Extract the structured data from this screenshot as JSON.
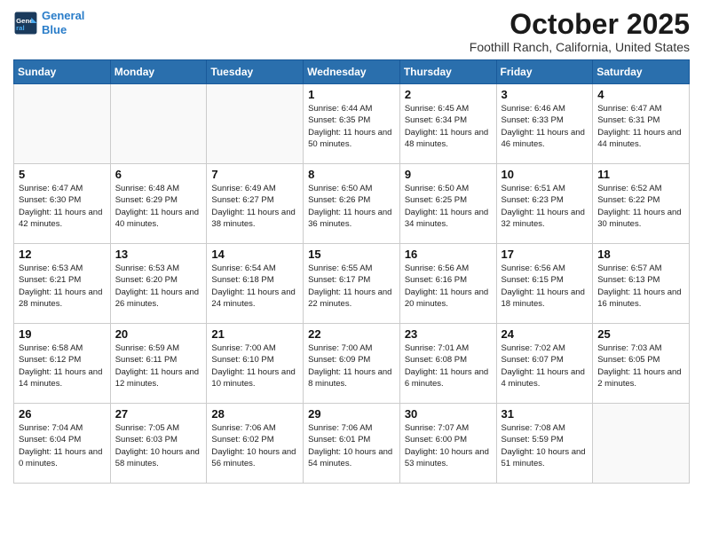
{
  "header": {
    "logo_line1": "General",
    "logo_line2": "Blue",
    "month": "October 2025",
    "location": "Foothill Ranch, California, United States"
  },
  "weekdays": [
    "Sunday",
    "Monday",
    "Tuesday",
    "Wednesday",
    "Thursday",
    "Friday",
    "Saturday"
  ],
  "weeks": [
    [
      {
        "day": "",
        "sunrise": "",
        "sunset": "",
        "daylight": ""
      },
      {
        "day": "",
        "sunrise": "",
        "sunset": "",
        "daylight": ""
      },
      {
        "day": "",
        "sunrise": "",
        "sunset": "",
        "daylight": ""
      },
      {
        "day": "1",
        "sunrise": "Sunrise: 6:44 AM",
        "sunset": "Sunset: 6:35 PM",
        "daylight": "Daylight: 11 hours and 50 minutes."
      },
      {
        "day": "2",
        "sunrise": "Sunrise: 6:45 AM",
        "sunset": "Sunset: 6:34 PM",
        "daylight": "Daylight: 11 hours and 48 minutes."
      },
      {
        "day": "3",
        "sunrise": "Sunrise: 6:46 AM",
        "sunset": "Sunset: 6:33 PM",
        "daylight": "Daylight: 11 hours and 46 minutes."
      },
      {
        "day": "4",
        "sunrise": "Sunrise: 6:47 AM",
        "sunset": "Sunset: 6:31 PM",
        "daylight": "Daylight: 11 hours and 44 minutes."
      }
    ],
    [
      {
        "day": "5",
        "sunrise": "Sunrise: 6:47 AM",
        "sunset": "Sunset: 6:30 PM",
        "daylight": "Daylight: 11 hours and 42 minutes."
      },
      {
        "day": "6",
        "sunrise": "Sunrise: 6:48 AM",
        "sunset": "Sunset: 6:29 PM",
        "daylight": "Daylight: 11 hours and 40 minutes."
      },
      {
        "day": "7",
        "sunrise": "Sunrise: 6:49 AM",
        "sunset": "Sunset: 6:27 PM",
        "daylight": "Daylight: 11 hours and 38 minutes."
      },
      {
        "day": "8",
        "sunrise": "Sunrise: 6:50 AM",
        "sunset": "Sunset: 6:26 PM",
        "daylight": "Daylight: 11 hours and 36 minutes."
      },
      {
        "day": "9",
        "sunrise": "Sunrise: 6:50 AM",
        "sunset": "Sunset: 6:25 PM",
        "daylight": "Daylight: 11 hours and 34 minutes."
      },
      {
        "day": "10",
        "sunrise": "Sunrise: 6:51 AM",
        "sunset": "Sunset: 6:23 PM",
        "daylight": "Daylight: 11 hours and 32 minutes."
      },
      {
        "day": "11",
        "sunrise": "Sunrise: 6:52 AM",
        "sunset": "Sunset: 6:22 PM",
        "daylight": "Daylight: 11 hours and 30 minutes."
      }
    ],
    [
      {
        "day": "12",
        "sunrise": "Sunrise: 6:53 AM",
        "sunset": "Sunset: 6:21 PM",
        "daylight": "Daylight: 11 hours and 28 minutes."
      },
      {
        "day": "13",
        "sunrise": "Sunrise: 6:53 AM",
        "sunset": "Sunset: 6:20 PM",
        "daylight": "Daylight: 11 hours and 26 minutes."
      },
      {
        "day": "14",
        "sunrise": "Sunrise: 6:54 AM",
        "sunset": "Sunset: 6:18 PM",
        "daylight": "Daylight: 11 hours and 24 minutes."
      },
      {
        "day": "15",
        "sunrise": "Sunrise: 6:55 AM",
        "sunset": "Sunset: 6:17 PM",
        "daylight": "Daylight: 11 hours and 22 minutes."
      },
      {
        "day": "16",
        "sunrise": "Sunrise: 6:56 AM",
        "sunset": "Sunset: 6:16 PM",
        "daylight": "Daylight: 11 hours and 20 minutes."
      },
      {
        "day": "17",
        "sunrise": "Sunrise: 6:56 AM",
        "sunset": "Sunset: 6:15 PM",
        "daylight": "Daylight: 11 hours and 18 minutes."
      },
      {
        "day": "18",
        "sunrise": "Sunrise: 6:57 AM",
        "sunset": "Sunset: 6:13 PM",
        "daylight": "Daylight: 11 hours and 16 minutes."
      }
    ],
    [
      {
        "day": "19",
        "sunrise": "Sunrise: 6:58 AM",
        "sunset": "Sunset: 6:12 PM",
        "daylight": "Daylight: 11 hours and 14 minutes."
      },
      {
        "day": "20",
        "sunrise": "Sunrise: 6:59 AM",
        "sunset": "Sunset: 6:11 PM",
        "daylight": "Daylight: 11 hours and 12 minutes."
      },
      {
        "day": "21",
        "sunrise": "Sunrise: 7:00 AM",
        "sunset": "Sunset: 6:10 PM",
        "daylight": "Daylight: 11 hours and 10 minutes."
      },
      {
        "day": "22",
        "sunrise": "Sunrise: 7:00 AM",
        "sunset": "Sunset: 6:09 PM",
        "daylight": "Daylight: 11 hours and 8 minutes."
      },
      {
        "day": "23",
        "sunrise": "Sunrise: 7:01 AM",
        "sunset": "Sunset: 6:08 PM",
        "daylight": "Daylight: 11 hours and 6 minutes."
      },
      {
        "day": "24",
        "sunrise": "Sunrise: 7:02 AM",
        "sunset": "Sunset: 6:07 PM",
        "daylight": "Daylight: 11 hours and 4 minutes."
      },
      {
        "day": "25",
        "sunrise": "Sunrise: 7:03 AM",
        "sunset": "Sunset: 6:05 PM",
        "daylight": "Daylight: 11 hours and 2 minutes."
      }
    ],
    [
      {
        "day": "26",
        "sunrise": "Sunrise: 7:04 AM",
        "sunset": "Sunset: 6:04 PM",
        "daylight": "Daylight: 11 hours and 0 minutes."
      },
      {
        "day": "27",
        "sunrise": "Sunrise: 7:05 AM",
        "sunset": "Sunset: 6:03 PM",
        "daylight": "Daylight: 10 hours and 58 minutes."
      },
      {
        "day": "28",
        "sunrise": "Sunrise: 7:06 AM",
        "sunset": "Sunset: 6:02 PM",
        "daylight": "Daylight: 10 hours and 56 minutes."
      },
      {
        "day": "29",
        "sunrise": "Sunrise: 7:06 AM",
        "sunset": "Sunset: 6:01 PM",
        "daylight": "Daylight: 10 hours and 54 minutes."
      },
      {
        "day": "30",
        "sunrise": "Sunrise: 7:07 AM",
        "sunset": "Sunset: 6:00 PM",
        "daylight": "Daylight: 10 hours and 53 minutes."
      },
      {
        "day": "31",
        "sunrise": "Sunrise: 7:08 AM",
        "sunset": "Sunset: 5:59 PM",
        "daylight": "Daylight: 10 hours and 51 minutes."
      },
      {
        "day": "",
        "sunrise": "",
        "sunset": "",
        "daylight": ""
      }
    ]
  ]
}
